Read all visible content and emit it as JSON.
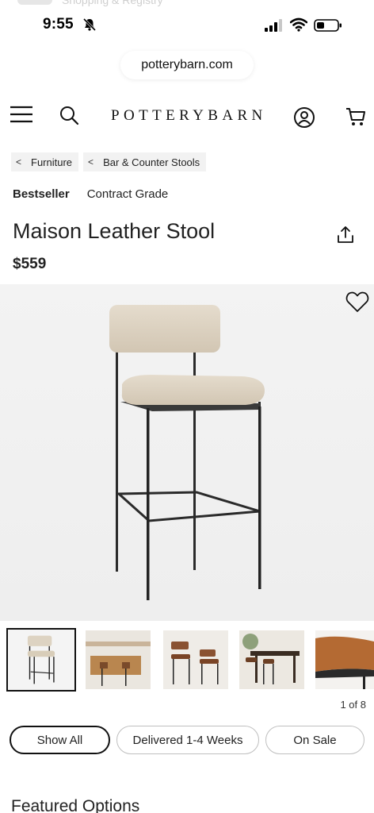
{
  "status_bar": {
    "time": "9:55",
    "ghost_text": "Shopping & Registry",
    "icons": [
      "bell-slash-icon",
      "signal-icon",
      "wifi-icon",
      "battery-icon"
    ]
  },
  "browser": {
    "url": "potterybarn.com"
  },
  "nav": {
    "logo": "POTTERYBARN",
    "icons": [
      "menu-icon",
      "search-icon",
      "account-icon",
      "cart-icon"
    ]
  },
  "breadcrumb": [
    {
      "chevron": "<",
      "label": "Furniture"
    },
    {
      "chevron": "<",
      "label": "Bar & Counter Stools"
    }
  ],
  "badges": {
    "bestseller": "Bestseller",
    "grade": "Contract Grade"
  },
  "product": {
    "title": "Maison Leather Stool",
    "price": "$559"
  },
  "gallery": {
    "current": 1,
    "total": 8,
    "counter": "1 of 8"
  },
  "filters": [
    {
      "label": "Show All",
      "selected": true
    },
    {
      "label": "Delivered 1-4 Weeks",
      "selected": false
    },
    {
      "label": "On Sale",
      "selected": false
    }
  ],
  "section": {
    "heading": "Featured Options"
  },
  "colors": {
    "text": "#222222",
    "hero_bg": "#f1f1f1",
    "seat_fabric": "#ddd3c2",
    "frame": "#222222"
  }
}
